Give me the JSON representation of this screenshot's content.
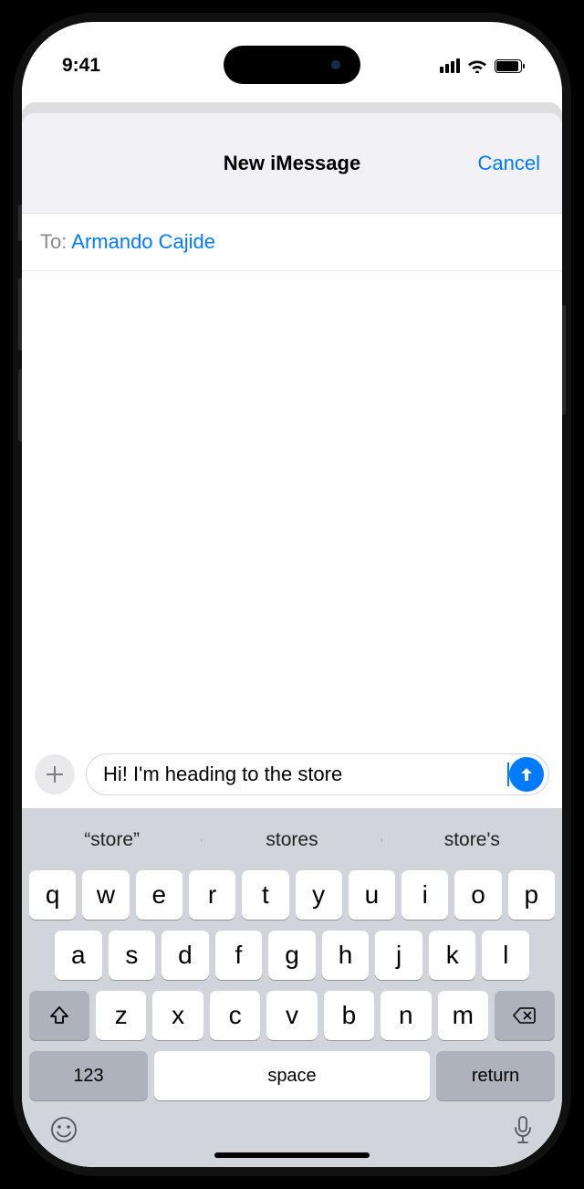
{
  "status": {
    "time": "9:41"
  },
  "sheet": {
    "title": "New iMessage",
    "cancel": "Cancel"
  },
  "to": {
    "label": "To:",
    "recipient": "Armando Cajide"
  },
  "input": {
    "text": "Hi! I'm heading to the store"
  },
  "suggestions": [
    "“store”",
    "stores",
    "store's"
  ],
  "keyboard": {
    "row1": [
      "q",
      "w",
      "e",
      "r",
      "t",
      "y",
      "u",
      "i",
      "o",
      "p"
    ],
    "row2": [
      "a",
      "s",
      "d",
      "f",
      "g",
      "h",
      "j",
      "k",
      "l"
    ],
    "row3": [
      "z",
      "x",
      "c",
      "v",
      "b",
      "n",
      "m"
    ],
    "numbers": "123",
    "space": "space",
    "return": "return"
  }
}
